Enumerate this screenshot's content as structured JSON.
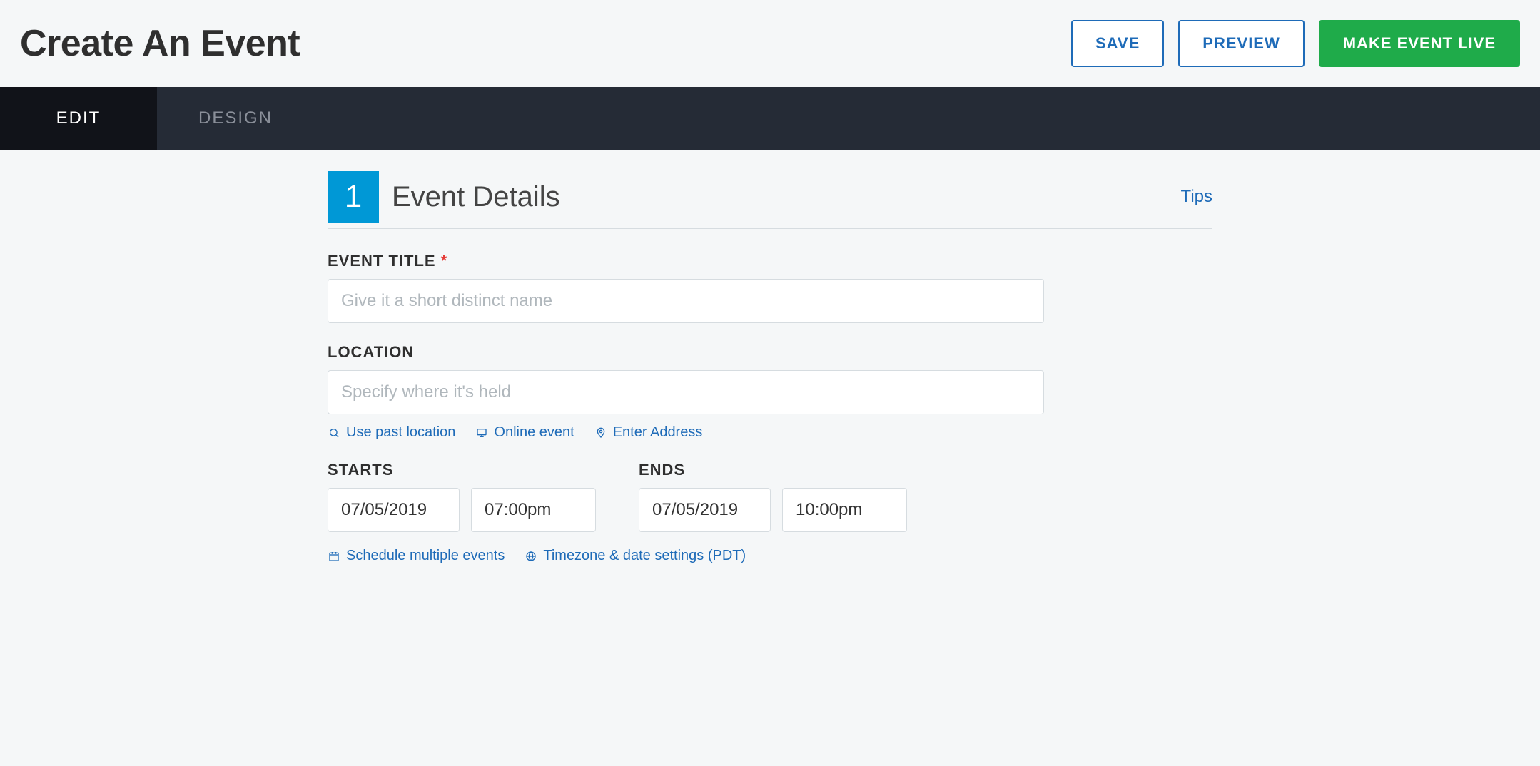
{
  "header": {
    "title": "Create An Event",
    "save_label": "SAVE",
    "preview_label": "PREVIEW",
    "publish_label": "MAKE EVENT LIVE"
  },
  "tabs": {
    "edit": "EDIT",
    "design": "DESIGN"
  },
  "section": {
    "step_number": "1",
    "title": "Event Details",
    "tips_label": "Tips"
  },
  "fields": {
    "event_title": {
      "label": "EVENT TITLE",
      "required_mark": "*",
      "placeholder": "Give it a short distinct name",
      "value": ""
    },
    "location": {
      "label": "LOCATION",
      "placeholder": "Specify where it's held",
      "value": "",
      "links": {
        "past_location": "Use past location",
        "online_event": "Online event",
        "enter_address": "Enter Address"
      }
    },
    "starts": {
      "label": "STARTS",
      "date": "07/05/2019",
      "time": "07:00pm"
    },
    "ends": {
      "label": "ENDS",
      "date": "07/05/2019",
      "time": "10:00pm"
    },
    "schedule_links": {
      "multiple": "Schedule multiple events",
      "timezone": "Timezone & date settings (PDT)"
    }
  }
}
